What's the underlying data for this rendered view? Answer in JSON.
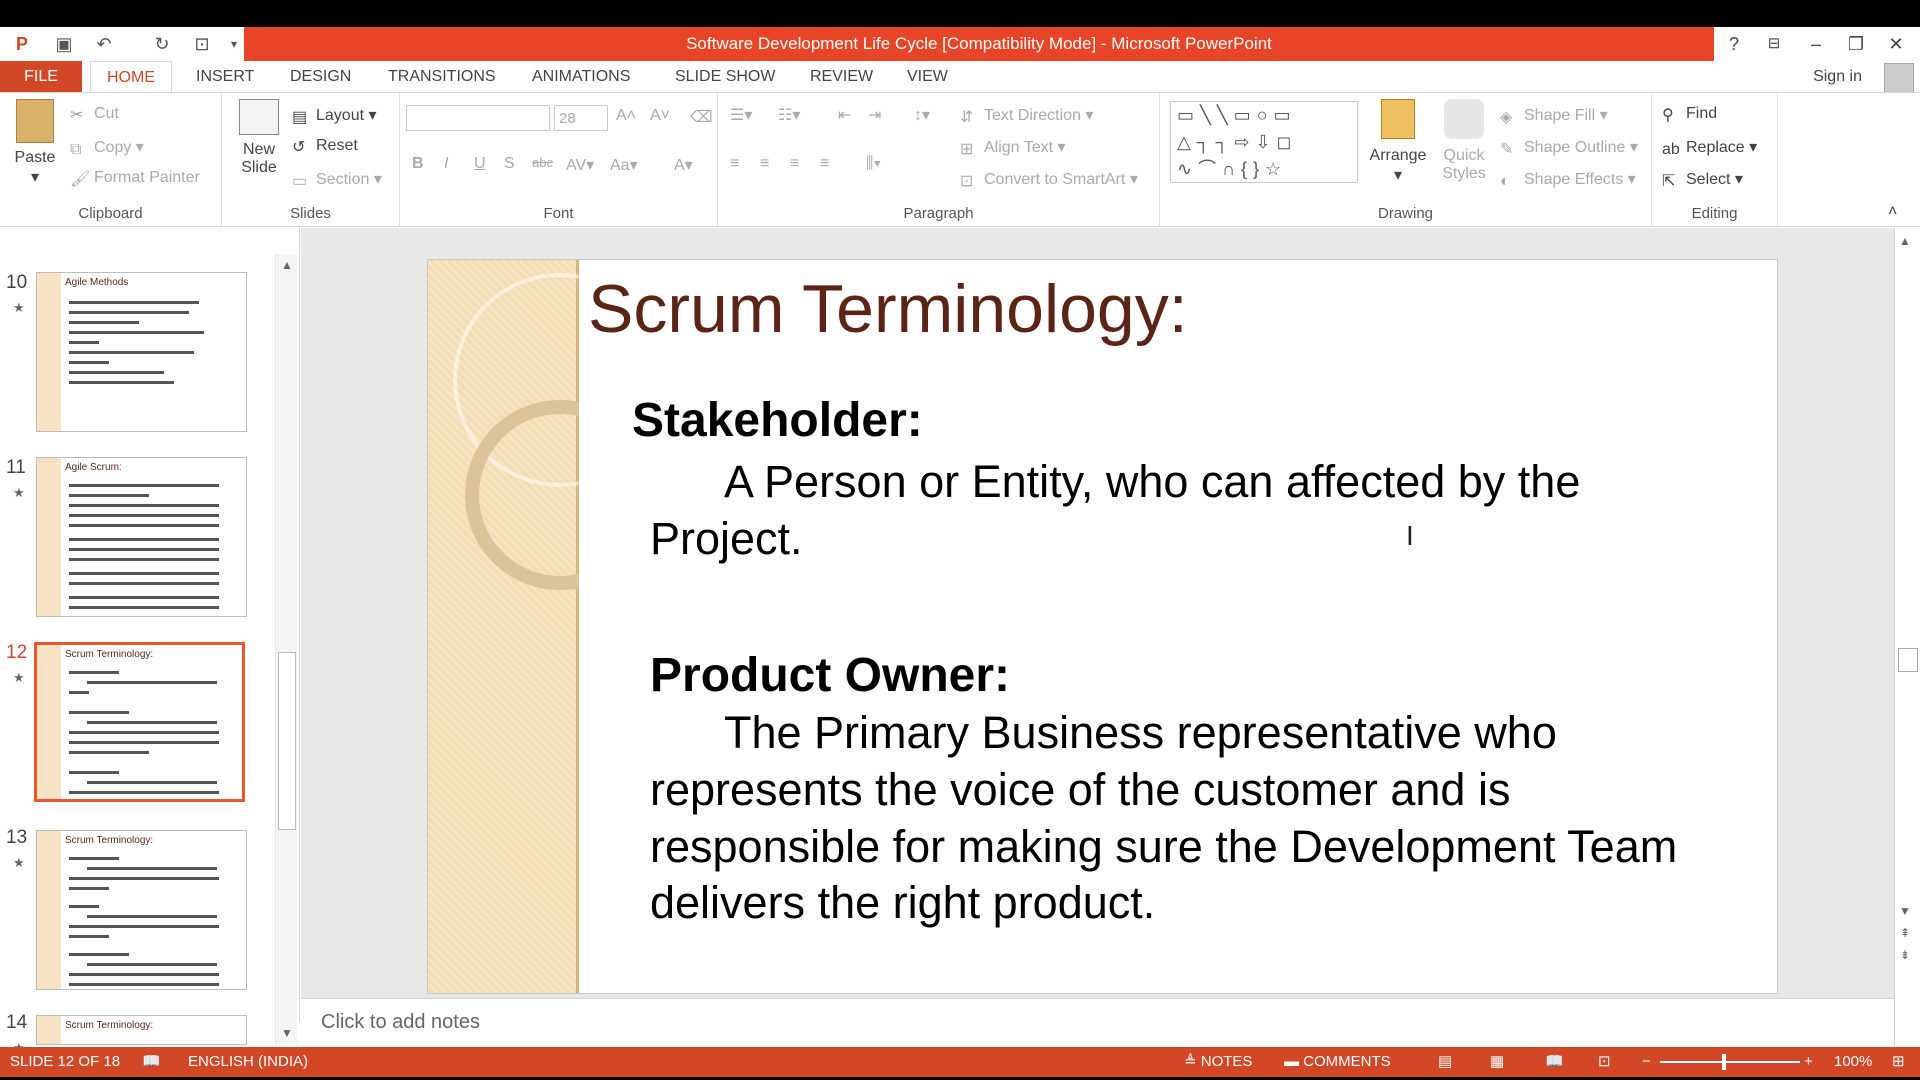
{
  "window": {
    "title": "Software Development Life Cycle [Compatibility Mode] -  Microsoft PowerPoint",
    "help": "?",
    "minimize": "–",
    "restore": "❐",
    "close": "✕"
  },
  "tabs": [
    "FILE",
    "HOME",
    "INSERT",
    "DESIGN",
    "TRANSITIONS",
    "ANIMATIONS",
    "SLIDE SHOW",
    "REVIEW",
    "VIEW"
  ],
  "signin": "Sign in",
  "ribbon": {
    "clipboard": {
      "paste": "Paste",
      "cut": "Cut",
      "copy": "Copy",
      "format_painter": "Format Painter",
      "label": "Clipboard"
    },
    "slides": {
      "new_slide": "New Slide",
      "layout": "Layout",
      "reset": "Reset",
      "section": "Section",
      "label": "Slides"
    },
    "font": {
      "font_size": "28",
      "label": "Font"
    },
    "paragraph": {
      "text_direction": "Text Direction",
      "align_text": "Align Text",
      "smartart": "Convert to SmartArt",
      "label": "Paragraph"
    },
    "drawing": {
      "arrange": "Arrange",
      "quick_styles": "Quick Styles",
      "shape_fill": "Shape Fill",
      "shape_outline": "Shape Outline",
      "shape_effects": "Shape Effects",
      "label": "Drawing"
    },
    "editing": {
      "find": "Find",
      "replace": "Replace",
      "select": "Select",
      "label": "Editing"
    }
  },
  "thumbnails": [
    {
      "num": "10",
      "title": "Agile Methods"
    },
    {
      "num": "11",
      "title": "Agile Scrum:"
    },
    {
      "num": "12",
      "title": "Scrum Terminology:"
    },
    {
      "num": "13",
      "title": "Scrum Terminology:"
    },
    {
      "num": "14",
      "title": "Scrum Terminology:"
    }
  ],
  "slide": {
    "title": "Scrum Terminology:",
    "term1": "Stakeholder:",
    "def1_line1": "A Person or Entity, who can affected by the",
    "def1_line2": "Project.",
    "term2": "Product Owner:",
    "def2_line1": "The Primary Business representative who",
    "def2_line2": "represents the voice of the customer and is",
    "def2_line3": "responsible for making sure the Development Team",
    "def2_line4": "delivers the right product."
  },
  "notes_placeholder": "Click to add notes",
  "status": {
    "slide": "SLIDE 12 OF 18",
    "language": "ENGLISH (INDIA)",
    "notes": "NOTES",
    "comments": "COMMENTS",
    "zoom": "100%"
  }
}
